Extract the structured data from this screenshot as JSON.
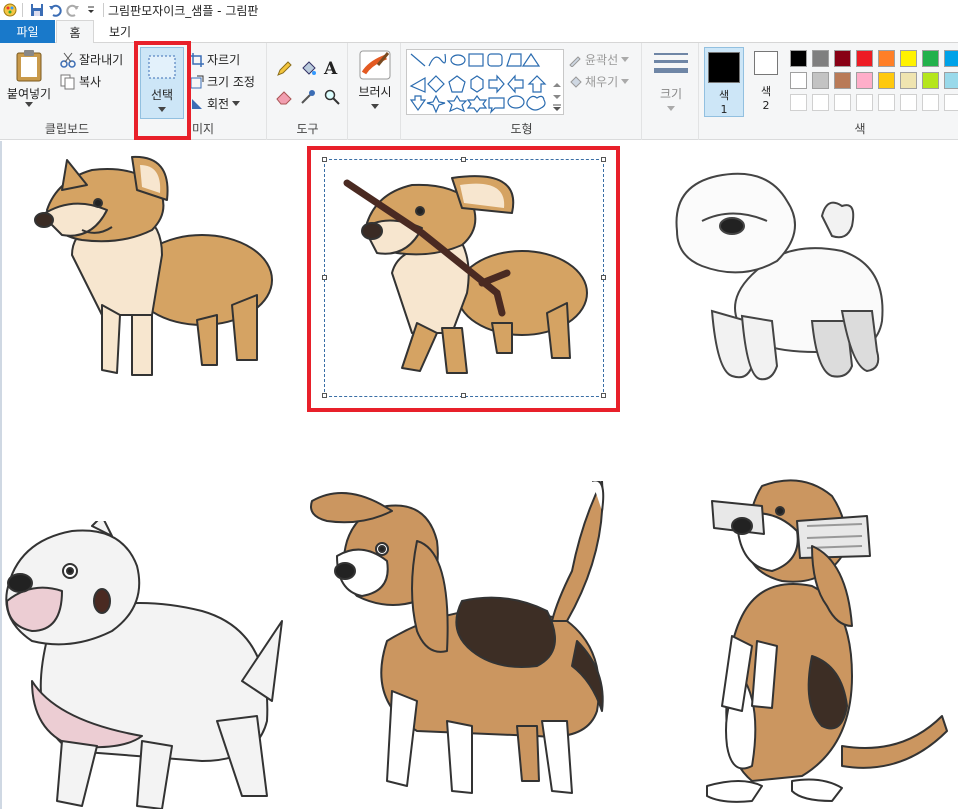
{
  "window": {
    "title": "그림판모자이크_샘플 - 그림판"
  },
  "tabs": {
    "file": "파일",
    "home": "홈",
    "view": "보기"
  },
  "clipboard": {
    "paste": "붙여넣기",
    "cut": "잘라내기",
    "copy": "복사",
    "label": "클립보드"
  },
  "image": {
    "select": "선택",
    "crop": "자르기",
    "resize": "크기 조정",
    "rotate": "회전",
    "label": "이미지",
    "label_visible": "미지"
  },
  "tools": {
    "label": "도구",
    "text_tool": "A"
  },
  "brushes": {
    "label": "브러시"
  },
  "shapes": {
    "outline": "윤곽선",
    "fill": "채우기",
    "label": "도형"
  },
  "size": {
    "label": "크기"
  },
  "colors": {
    "color1": "색\n1",
    "color1_a": "색",
    "color1_b": "1",
    "color2_a": "색",
    "color2_b": "2",
    "label": "색",
    "color1_value": "#000000",
    "color2_value": "#ffffff",
    "palette_row1": [
      "#000000",
      "#7f7f7f",
      "#880015",
      "#ed1c24",
      "#ff7f27",
      "#fff200",
      "#22b14c",
      "#00a2e8"
    ],
    "palette_row2": [
      "#ffffff",
      "#c3c3c3",
      "#b97a57",
      "#ffaec9",
      "#ffc90e",
      "#efe4b0",
      "#b5e61d",
      "#99d9ea"
    ],
    "palette_row3": [
      "#ffffff",
      "#ffffff",
      "#ffffff",
      "#ffffff",
      "#ffffff",
      "#ffffff",
      "#ffffff",
      "#ffffff"
    ]
  },
  "canvas": {
    "dogs": [
      "corgi",
      "corgi-with-stick",
      "bichon",
      "pitbull",
      "beagle",
      "beagle-with-newspaper"
    ],
    "selection_active": true
  }
}
